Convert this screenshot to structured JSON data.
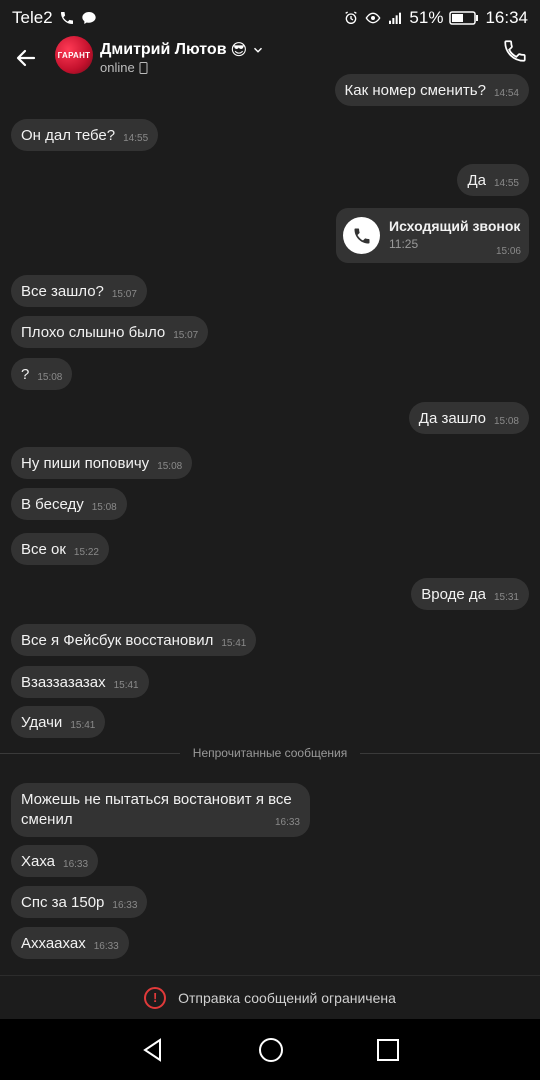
{
  "statusbar": {
    "carrier": "Tele2",
    "battery": "51%",
    "time": "16:34"
  },
  "header": {
    "avatar_text": "ГАРАНТ",
    "name": "Дмитрий Лютов",
    "emoji": "😎",
    "status": "online"
  },
  "messages": [
    {
      "text": "Как номер сменить?",
      "time": "14:54"
    },
    {
      "text": "Он дал тебе?",
      "time": "14:55"
    },
    {
      "text": "Да",
      "time": "14:55"
    },
    {
      "text": "Все зашло?",
      "time": "15:07"
    },
    {
      "text": "Плохо слышно было",
      "time": "15:07"
    },
    {
      "text": "?",
      "time": "15:08"
    },
    {
      "text": "Да зашло",
      "time": "15:08"
    },
    {
      "text": "Ну пиши поповичу",
      "time": "15:08"
    },
    {
      "text": "В беседу",
      "time": "15:08"
    },
    {
      "text": "Все ок",
      "time": "15:22"
    },
    {
      "text": "Вроде да",
      "time": "15:31"
    },
    {
      "text": "Все я Фейсбук восстановил",
      "time": "15:41"
    },
    {
      "text": "Взаззазазах",
      "time": "15:41"
    },
    {
      "text": "Удачи",
      "time": "15:41"
    },
    {
      "text": "Можешь не пытаться востановит я все сменил",
      "time": "16:33"
    },
    {
      "text": "Хаха",
      "time": "16:33"
    },
    {
      "text": "Спс за 150р",
      "time": "16:33"
    },
    {
      "text": "Аххаахах",
      "time": "16:33"
    }
  ],
  "call": {
    "title": "Исходящий звонок",
    "duration": "11:25",
    "time": "15:06"
  },
  "divider": "Непрочитанные сообщения",
  "footer": {
    "restricted": "Отправка сообщений ограничена"
  },
  "colors": {
    "background": "#1c1c1c",
    "bubble": "#333333",
    "warning": "#e03a3a"
  }
}
